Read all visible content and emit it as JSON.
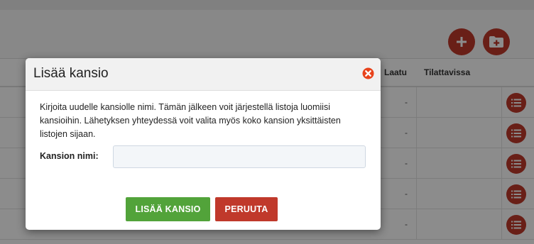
{
  "table": {
    "columns": [
      "Laatu",
      "Tilattavissa"
    ],
    "rows": [
      {
        "laatu": "-"
      },
      {
        "laatu": "-"
      },
      {
        "laatu": "-"
      },
      {
        "laatu": "-"
      },
      {
        "laatu": "-"
      }
    ]
  },
  "toolbar": {
    "add_icon": "plus-icon",
    "add_folder_icon": "folder-plus-icon"
  },
  "modal": {
    "title": "Lisää kansio",
    "description": "Kirjoita uudelle kansiolle nimi. Tämän jälkeen voit järjestellä listoja luomiisi kansioihin. Lähetyksen yhteydessä voit valita myös koko kansion yksittäisten listojen sijaan.",
    "field_label": "Kansion nimi:",
    "field_value": "",
    "add_button": "LISÄÄ KANSIO",
    "cancel_button": "PERUUTA"
  },
  "colors": {
    "accent_red": "#c0392b",
    "add_green": "#52a33a",
    "close_orange": "#e8431c"
  }
}
